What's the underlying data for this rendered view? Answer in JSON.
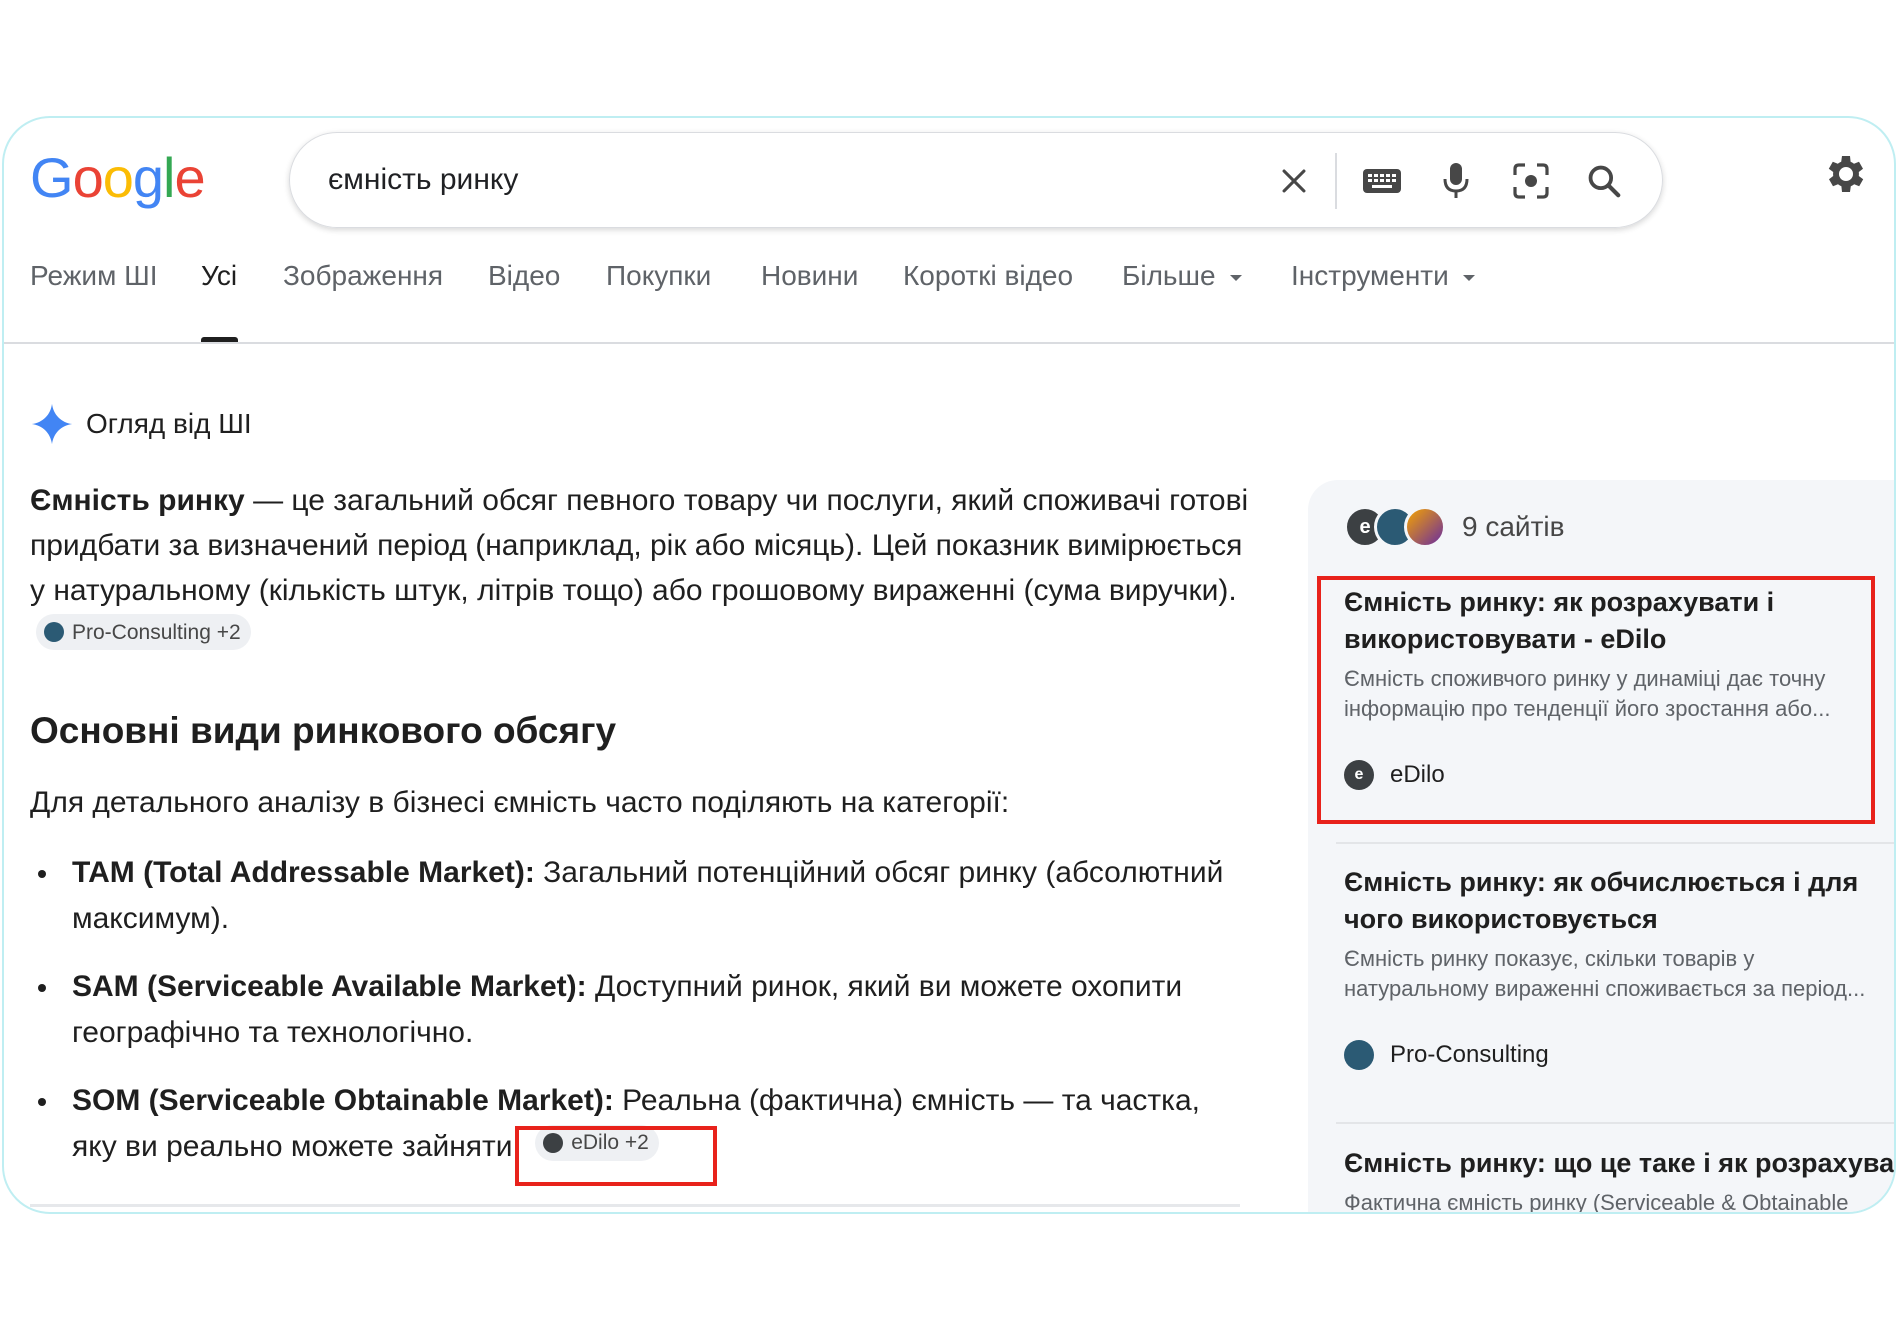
{
  "logo": {
    "letters": [
      "G",
      "o",
      "o",
      "g",
      "l",
      "e"
    ],
    "colors": [
      "#4285F4",
      "#EA4335",
      "#FBBC05",
      "#4285F4",
      "#34A853",
      "#EA4335"
    ]
  },
  "search": {
    "query": "ємність ринку",
    "icons": [
      "close-icon",
      "keyboard-icon",
      "mic-icon",
      "lens-icon",
      "search-icon"
    ]
  },
  "tabs": [
    {
      "label": "Режим ШІ"
    },
    {
      "label": "Усі"
    },
    {
      "label": "Зображення"
    },
    {
      "label": "Відео"
    },
    {
      "label": "Покупки"
    },
    {
      "label": "Новини"
    },
    {
      "label": "Короткі відео"
    },
    {
      "label": "Більше"
    },
    {
      "label": "Інструменти"
    }
  ],
  "ai_overview": {
    "title": "Огляд від ШІ",
    "para_bold": "Ємність ринку",
    "para_text": " — це загальний обсяг певного товару чи послуги, який споживачі готові придбати за визначений період (наприклад, рік або місяць). Цей показник вимірюється у натуральному (кількість штук, літрів тощо) або грошовому вираженні (сума виручки).",
    "para_chip": "Pro-Consulting +2",
    "heading": "Основні види ринкового обсягу",
    "intro": "Для детального аналізу в бізнесі ємність часто поділяють на категорії:",
    "bullets": [
      {
        "bold": "TAM (Total Addressable Market):",
        "text": " Загальний потенційний обсяг ринку (абсолютний максимум)."
      },
      {
        "bold": "SAM (Serviceable Available Market):",
        "text": " Доступний ринок, який ви можете охопити географічно та технологічно."
      },
      {
        "bold": "SOM (Serviceable Obtainable Market):",
        "text": " Реальна (фактична) ємність — та частка, яку ви реально можете зайняти."
      }
    ],
    "bullet_chip": "eDilo +2"
  },
  "sources": {
    "count_label": "9 сайтів",
    "avatar_letter": "e",
    "cards": [
      {
        "title": "Ємність ринку: як розрахувати і використовувати - eDilo",
        "snippet": "Ємність споживчого ринку у динаміці дає точну інформацію про тенденції його зростання або...",
        "source": "eDilo"
      },
      {
        "title": "Ємність ринку: як обчислюється і для чого використовується",
        "snippet": "Ємність ринку показує, скільки товарів у натуральному вираженні споживається за період...",
        "source": "Pro-Consulting"
      },
      {
        "title": "Ємність ринку: що це таке і як розрахувати",
        "snippet": "Фактична ємність ринку (Serviceable & Obtainable Market, SOM) — кількість продукції, яка реально...",
        "source": ""
      }
    ]
  },
  "colors": {
    "highlight": "#e8221b",
    "ai_star": "#4285F4"
  }
}
